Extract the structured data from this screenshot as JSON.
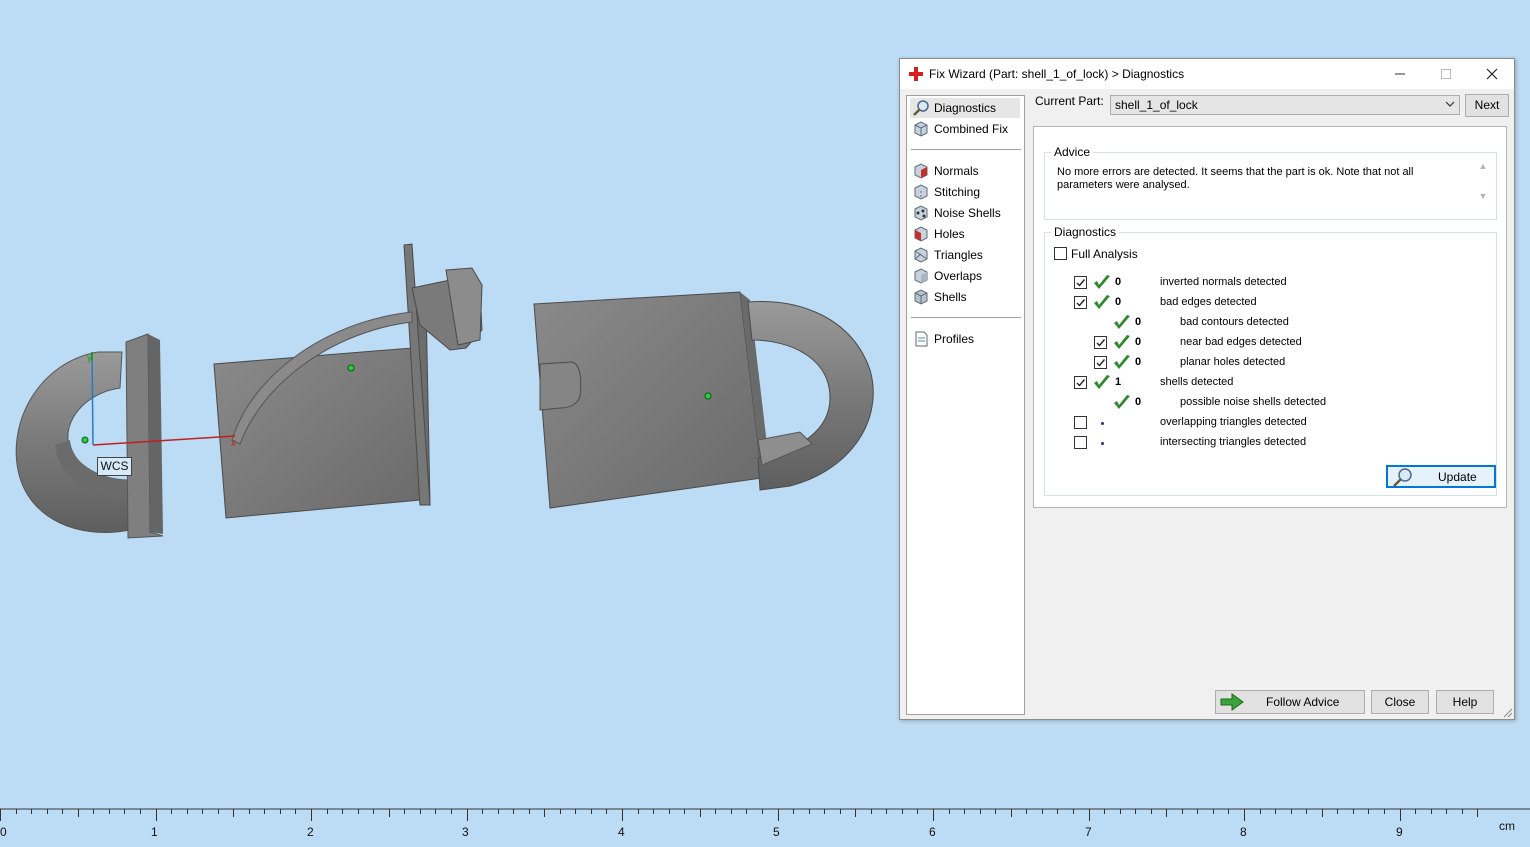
{
  "dialog": {
    "title": "Fix Wizard (Part: shell_1_of_lock) > Diagnostics",
    "nav": {
      "items": [
        {
          "label": "Diagnostics",
          "icon": "magnifier-icon",
          "selected": true
        },
        {
          "label": "Combined Fix",
          "icon": "cube-icon"
        },
        {
          "label": "Normals",
          "icon": "normals-cube-icon"
        },
        {
          "label": "Stitching",
          "icon": "stitching-cube-icon"
        },
        {
          "label": "Noise Shells",
          "icon": "noise-shells-icon"
        },
        {
          "label": "Holes",
          "icon": "holes-cube-icon"
        },
        {
          "label": "Triangles",
          "icon": "triangles-cube-icon"
        },
        {
          "label": "Overlaps",
          "icon": "overlaps-cube-icon"
        },
        {
          "label": "Shells",
          "icon": "shells-cube-icon"
        },
        {
          "label": "Profiles",
          "icon": "document-icon"
        }
      ]
    },
    "current_part_label": "Current Part:",
    "current_part_value": "shell_1_of_lock",
    "next_label": "Next",
    "advice": {
      "title": "Advice",
      "text": "No more errors are detected. It seems that the part is ok. Note that not all parameters were analysed."
    },
    "diagnostics": {
      "title": "Diagnostics",
      "full_analysis_label": "Full Analysis",
      "full_analysis_checked": false,
      "rows": [
        {
          "checked": true,
          "status": "ok",
          "value": "0",
          "label": "inverted normals detected",
          "indent": 0,
          "has_checkbox": true
        },
        {
          "checked": true,
          "status": "ok",
          "value": "0",
          "label": "bad edges detected",
          "indent": 0,
          "has_checkbox": true
        },
        {
          "checked": null,
          "status": "ok",
          "value": "0",
          "label": "bad contours detected",
          "indent": 1,
          "has_checkbox": false
        },
        {
          "checked": true,
          "status": "ok",
          "value": "0",
          "label": "near bad edges detected",
          "indent": 1,
          "has_checkbox": true
        },
        {
          "checked": true,
          "status": "ok",
          "value": "0",
          "label": "planar holes detected",
          "indent": 1,
          "has_checkbox": true
        },
        {
          "checked": true,
          "status": "ok",
          "value": "1",
          "label": "shells detected",
          "indent": 0,
          "has_checkbox": true
        },
        {
          "checked": null,
          "status": "ok",
          "value": "0",
          "label": "possible noise shells detected",
          "indent": 1,
          "has_checkbox": false
        },
        {
          "checked": false,
          "status": "unknown",
          "value": "",
          "label": "overlapping triangles detected",
          "indent": 0,
          "has_checkbox": true
        },
        {
          "checked": false,
          "status": "unknown",
          "value": "",
          "label": "intersecting triangles detected",
          "indent": 0,
          "has_checkbox": true
        }
      ],
      "update_label": "Update"
    },
    "buttons": {
      "follow_advice": "Follow Advice",
      "close": "Close",
      "help": "Help"
    }
  },
  "viewport": {
    "wcs_label": "WCS",
    "background_color": "#bcdcf5",
    "model_color": "#7a7a7a"
  },
  "ruler": {
    "labels": [
      "0",
      "1",
      "2",
      "3",
      "4",
      "5",
      "6",
      "7",
      "8",
      "9"
    ],
    "unit": "cm"
  }
}
